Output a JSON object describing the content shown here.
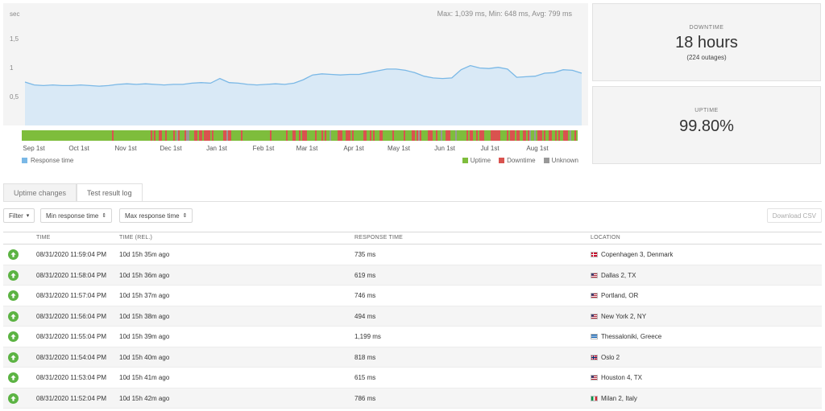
{
  "chart": {
    "stats": "Max: 1,039 ms, Min: 648 ms, Avg: 799 ms",
    "y_unit": "sec",
    "y_ticks": [
      "1,5",
      "1",
      "0,5"
    ],
    "x_ticks": [
      "Sep 1st",
      "Oct 1st",
      "Nov 1st",
      "Dec 1st",
      "Jan 1st",
      "Feb 1st",
      "Mar 1st",
      "Apr 1st",
      "May 1st",
      "Jun 1st",
      "Jul 1st",
      "Aug 1st"
    ],
    "legend_response": "Response time",
    "legend_uptime": "Uptime",
    "legend_downtime": "Downtime",
    "legend_unknown": "Unknown",
    "colors": {
      "line": "#7ab8e6",
      "fill": "#d9e9f6",
      "uptime": "#7ebd3c",
      "downtime": "#d9534f",
      "unknown": "#999999",
      "response_swatch": "#7ab8e6"
    }
  },
  "chart_data": {
    "type": "area",
    "title": "",
    "ylabel": "sec",
    "ylim": [
      0,
      2
    ],
    "x_range": [
      "Sep 1st",
      "Aug 31st"
    ],
    "series": [
      {
        "name": "Response time",
        "values": [
          0.74,
          0.69,
          0.68,
          0.69,
          0.68,
          0.68,
          0.69,
          0.68,
          0.67,
          0.68,
          0.7,
          0.71,
          0.7,
          0.71,
          0.7,
          0.69,
          0.7,
          0.7,
          0.72,
          0.73,
          0.72,
          0.8,
          0.73,
          0.72,
          0.7,
          0.69,
          0.7,
          0.71,
          0.7,
          0.72,
          0.78,
          0.86,
          0.88,
          0.87,
          0.86,
          0.87,
          0.87,
          0.9,
          0.93,
          0.96,
          0.96,
          0.94,
          0.9,
          0.84,
          0.81,
          0.8,
          0.81,
          0.95,
          1.02,
          0.98,
          0.97,
          0.99,
          0.96,
          0.82,
          0.83,
          0.84,
          0.89,
          0.9,
          0.95,
          0.94,
          0.89
        ]
      }
    ],
    "stats": {
      "max_ms": 1039,
      "min_ms": 648,
      "avg_ms": 799
    }
  },
  "downtime_box": {
    "label": "DOWNTIME",
    "value": "18 hours",
    "sub": "(224 outages)"
  },
  "uptime_box": {
    "label": "UPTIME",
    "value": "99.80%"
  },
  "tabs": [
    "Uptime changes",
    "Test result log"
  ],
  "toolbar": {
    "filter": "Filter",
    "min_sort": "Min response time",
    "max_sort": "Max response time",
    "download": "Download CSV"
  },
  "table": {
    "headers": [
      "TIME",
      "TIME (REL.)",
      "RESPONSE TIME",
      "LOCATION"
    ],
    "rows": [
      {
        "time": "08/31/2020 11:59:04 PM",
        "rel": "10d 15h 35m ago",
        "response": "735 ms",
        "location": "Copenhagen 3, Denmark",
        "flag": "denmark-flag-icon"
      },
      {
        "time": "08/31/2020 11:58:04 PM",
        "rel": "10d 15h 36m ago",
        "response": "619 ms",
        "location": "Dallas 2, TX",
        "flag": "us-flag-icon"
      },
      {
        "time": "08/31/2020 11:57:04 PM",
        "rel": "10d 15h 37m ago",
        "response": "746 ms",
        "location": "Portland, OR",
        "flag": "us-flag-icon"
      },
      {
        "time": "08/31/2020 11:56:04 PM",
        "rel": "10d 15h 38m ago",
        "response": "494 ms",
        "location": "New York 2, NY",
        "flag": "us-flag-icon"
      },
      {
        "time": "08/31/2020 11:55:04 PM",
        "rel": "10d 15h 39m ago",
        "response": "1,199 ms",
        "location": "Thessaloniki, Greece",
        "flag": "greece-flag-icon"
      },
      {
        "time": "08/31/2020 11:54:04 PM",
        "rel": "10d 15h 40m ago",
        "response": "818 ms",
        "location": "Oslo 2",
        "flag": "norway-flag-icon"
      },
      {
        "time": "08/31/2020 11:53:04 PM",
        "rel": "10d 15h 41m ago",
        "response": "615 ms",
        "location": "Houston 4, TX",
        "flag": "us-flag-icon"
      },
      {
        "time": "08/31/2020 11:52:04 PM",
        "rel": "10d 15h 42m ago",
        "response": "786 ms",
        "location": "Milan 2, Italy",
        "flag": "italy-flag-icon"
      }
    ]
  }
}
